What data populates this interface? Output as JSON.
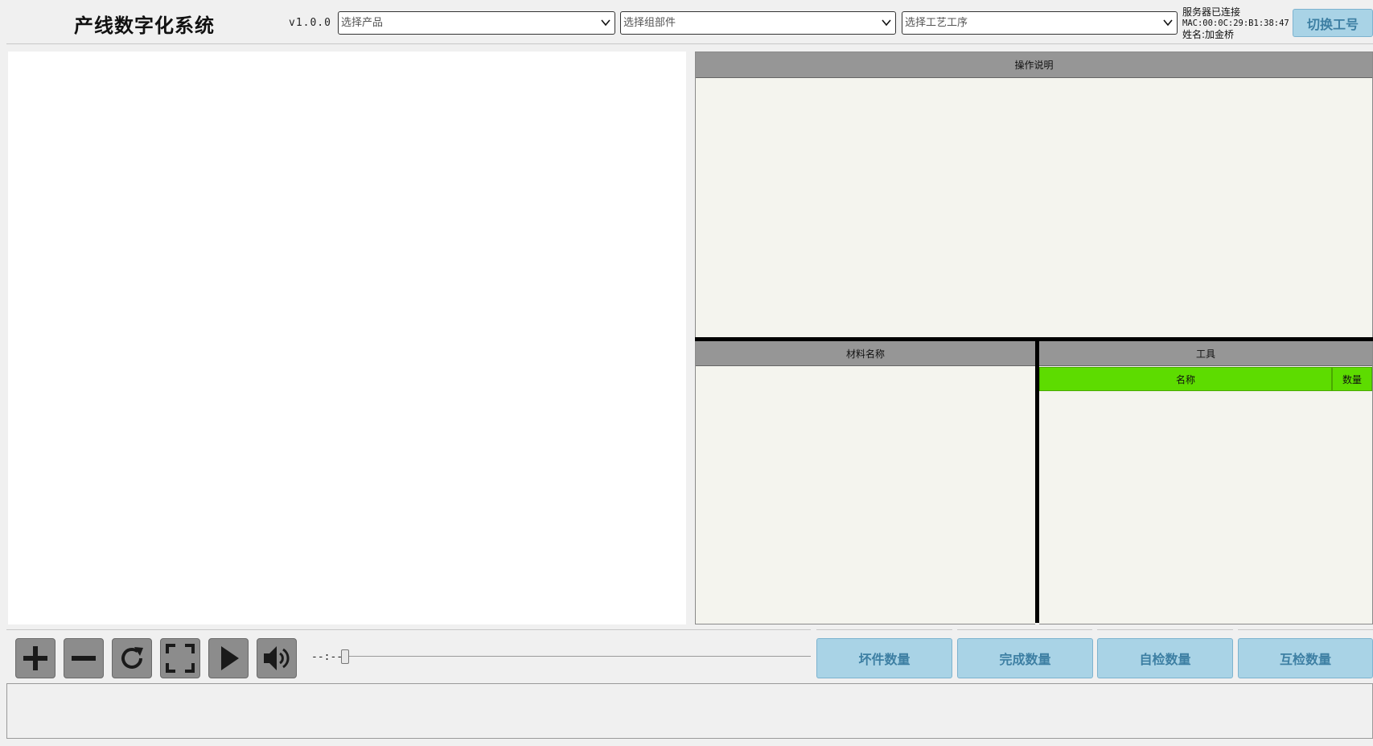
{
  "header": {
    "title": "产线数字化系统",
    "version": "v1.0.0",
    "product_select": {
      "placeholder": "选择产品"
    },
    "assembly_select": {
      "placeholder": "选择组部件"
    },
    "process_select": {
      "placeholder": "选择工艺工序"
    },
    "server_status": "服务器已连接",
    "mac_address": "MAC:00:0C:29:B1:38:47",
    "operator_name": "姓名:加金桥",
    "switch_id_label": "切换工号"
  },
  "panels": {
    "instructions_title": "操作说明",
    "materials_title": "材料名称",
    "tools_title": "工具",
    "tools_columns": {
      "name": "名称",
      "quantity": "数量"
    }
  },
  "player": {
    "time": "--:--",
    "progress": 0,
    "icons": [
      "plus-icon",
      "minus-icon",
      "rotate-icon",
      "fullscreen-icon",
      "play-icon",
      "volume-icon"
    ]
  },
  "counters": {
    "defect": "坏件数量",
    "complete": "完成数量",
    "self_check": "自检数量",
    "mutual_check": "互检数量"
  },
  "colors": {
    "accent_button": "#a9d3e6",
    "tools_header_green": "#5ddc00",
    "panel_header": "#969696"
  }
}
